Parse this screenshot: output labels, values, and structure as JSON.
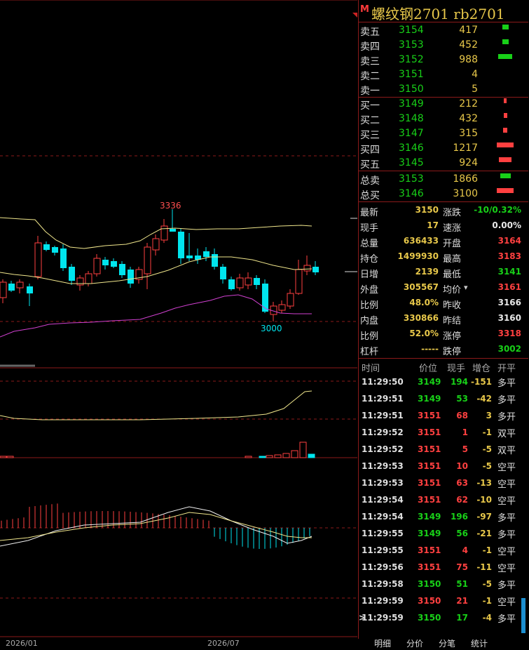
{
  "title": {
    "flag": "M",
    "name": "螺纹钢2701  rb2701"
  },
  "order_book": {
    "asks": [
      {
        "label": "卖五",
        "price": "3154",
        "vol": "417",
        "bar": 9
      },
      {
        "label": "卖四",
        "price": "3153",
        "vol": "452",
        "bar": 9
      },
      {
        "label": "卖三",
        "price": "3152",
        "vol": "988",
        "bar": 20
      },
      {
        "label": "卖二",
        "price": "3151",
        "vol": "4",
        "bar": 0
      },
      {
        "label": "卖一",
        "price": "3150",
        "vol": "5",
        "bar": 0
      }
    ],
    "bids": [
      {
        "label": "买一",
        "price": "3149",
        "vol": "212",
        "bar": 4
      },
      {
        "label": "买二",
        "price": "3148",
        "vol": "432",
        "bar": 5
      },
      {
        "label": "买三",
        "price": "3147",
        "vol": "315",
        "bar": 6
      },
      {
        "label": "买四",
        "price": "3146",
        "vol": "1217",
        "bar": 24
      },
      {
        "label": "买五",
        "price": "3145",
        "vol": "924",
        "bar": 18
      }
    ],
    "totals": [
      {
        "label": "总卖",
        "price": "3153",
        "vol": "1866",
        "color": "#18d018",
        "bar": 15
      },
      {
        "label": "总买",
        "price": "3146",
        "vol": "3100",
        "color": "#ff4040",
        "bar": 24
      }
    ]
  },
  "stats": [
    {
      "k1": "最新",
      "v1": "3150",
      "c1": "y",
      "k2": "涨跌",
      "v2": "-10/0.32%",
      "c2": "g"
    },
    {
      "k1": "现手",
      "v1": "17",
      "c1": "y",
      "k2": "速涨",
      "v2": "0.00%",
      "c2": "w"
    },
    {
      "k1": "总量",
      "v1": "636433",
      "c1": "y",
      "k2": "开盘",
      "v2": "3164",
      "c2": "r"
    },
    {
      "k1": "持仓",
      "v1": "1499930",
      "c1": "y",
      "k2": "最高",
      "v2": "3183",
      "c2": "r"
    },
    {
      "k1": "日增",
      "v1": "2139",
      "c1": "y",
      "k2": "最低",
      "v2": "3141",
      "c2": "g"
    },
    {
      "k1": "外盘",
      "v1": "305567",
      "c1": "y",
      "k2": "均价",
      "v2": "3161",
      "c2": "r"
    },
    {
      "k1": "比例",
      "v1": "48.0%",
      "c1": "y",
      "k2": "昨收",
      "v2": "3166",
      "c2": "w"
    },
    {
      "k1": "内盘",
      "v1": "330866",
      "c1": "y",
      "k2": "昨结",
      "v2": "3160",
      "c2": "w"
    },
    {
      "k1": "比例",
      "v1": "52.0%",
      "c1": "y",
      "k2": "涨停",
      "v2": "3318",
      "c2": "r"
    },
    {
      "k1": "杠杆",
      "v1": "-----",
      "c1": "y",
      "k2": "跌停",
      "v2": "3002",
      "c2": "g"
    }
  ],
  "ticks_header": {
    "time": "时间",
    "price": "价位",
    "vol": "现手",
    "chg": "增仓",
    "type": "开平"
  },
  "ticks": [
    {
      "time": "11:29:50",
      "price": "3149",
      "vol": "194",
      "chg": "-151",
      "type": "多平",
      "vc": "g"
    },
    {
      "time": "11:29:51",
      "price": "3149",
      "vol": "53",
      "chg": "-42",
      "type": "多平",
      "vc": "g"
    },
    {
      "time": "11:29:51",
      "price": "3151",
      "vol": "68",
      "chg": "3",
      "type": "多开",
      "vc": "r"
    },
    {
      "time": "11:29:52",
      "price": "3151",
      "vol": "1",
      "chg": "-1",
      "type": "双平",
      "vc": "r"
    },
    {
      "time": "11:29:52",
      "price": "3151",
      "vol": "5",
      "chg": "-5",
      "type": "双平",
      "vc": "r"
    },
    {
      "time": "11:29:53",
      "price": "3151",
      "vol": "10",
      "chg": "-5",
      "type": "空平",
      "vc": "r"
    },
    {
      "time": "11:29:53",
      "price": "3151",
      "vol": "63",
      "chg": "-13",
      "type": "空平",
      "vc": "r"
    },
    {
      "time": "11:29:54",
      "price": "3151",
      "vol": "62",
      "chg": "-10",
      "type": "空平",
      "vc": "r"
    },
    {
      "time": "11:29:54",
      "price": "3149",
      "vol": "196",
      "chg": "-97",
      "type": "多平",
      "vc": "g"
    },
    {
      "time": "11:29:55",
      "price": "3149",
      "vol": "56",
      "chg": "-21",
      "type": "多平",
      "vc": "g"
    },
    {
      "time": "11:29:55",
      "price": "3151",
      "vol": "4",
      "chg": "-1",
      "type": "空平",
      "vc": "r"
    },
    {
      "time": "11:29:56",
      "price": "3151",
      "vol": "75",
      "chg": "-11",
      "type": "空平",
      "vc": "r"
    },
    {
      "time": "11:29:58",
      "price": "3150",
      "vol": "51",
      "chg": "-5",
      "type": "多平",
      "vc": "g"
    },
    {
      "time": "11:29:59",
      "price": "3150",
      "vol": "21",
      "chg": "-1",
      "type": "空平",
      "vc": "r"
    },
    {
      "time": "11:29:59",
      "price": "3150",
      "vol": "17",
      "chg": "-4",
      "type": "多平",
      "vc": "g"
    }
  ],
  "tabs": [
    "明细",
    "分价",
    "分笔",
    "统计"
  ],
  "chart": {
    "high_label": "3336",
    "low_label": "3000",
    "x_labels": [
      "2026/01",
      "2026/07"
    ]
  },
  "colors": {
    "up": "#ff4040",
    "down": "#00e5ee",
    "ma": "#f0e68c",
    "lower": "#d040d0"
  }
}
